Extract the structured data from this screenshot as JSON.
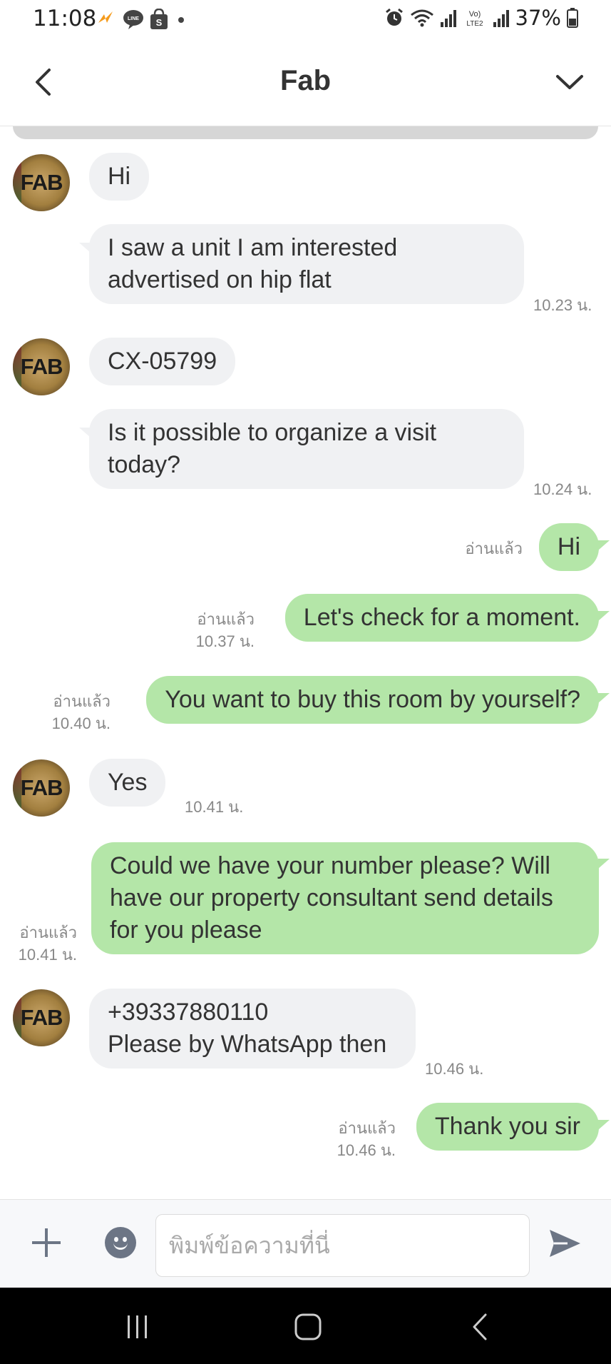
{
  "status_bar": {
    "time": "11:08",
    "battery": "37%",
    "left_icons": [
      "charging-app-icon",
      "line-icon",
      "shopee-icon",
      "dot-icon"
    ],
    "right_icons": [
      "alarm-icon",
      "wifi-icon",
      "signal-icon",
      "volte-icon",
      "signal-icon",
      "battery-icon"
    ]
  },
  "header": {
    "title": "Fab"
  },
  "avatar_text": "FAB",
  "messages": [
    {
      "side": "in",
      "text": "Hi"
    },
    {
      "side": "in",
      "text": "I saw a unit I am interested advertised on hip flat",
      "time": "10.23 น."
    },
    {
      "side": "in",
      "text": "CX-05799"
    },
    {
      "side": "in",
      "text": "Is it possible to organize a visit today?",
      "time": "10.24 น."
    },
    {
      "side": "out",
      "text": "Hi",
      "read": "อ่านแล้ว"
    },
    {
      "side": "out",
      "text": "Let's check for a moment.",
      "read": "อ่านแล้ว",
      "time": "10.37 น."
    },
    {
      "side": "out",
      "text": "You want to buy this room by yourself?",
      "read": "อ่านแล้ว",
      "time": "10.40 น."
    },
    {
      "side": "in",
      "text": "Yes",
      "time": "10.41 น."
    },
    {
      "side": "out",
      "text": "Could we have your number please? Will have our property consultant send details for you please",
      "read": "อ่านแล้ว",
      "time": "10.41 น."
    },
    {
      "side": "in",
      "text": "+39337880110\nPlease by WhatsApp then",
      "time": "10.46 น."
    },
    {
      "side": "out",
      "text": "Thank you sir",
      "read": "อ่านแล้ว",
      "time": "10.46 น."
    }
  ],
  "input": {
    "placeholder": "พิมพ์ข้อความที่นี่"
  },
  "colors": {
    "incoming_bubble": "#f0f1f3",
    "outgoing_bubble": "#b4e6a8",
    "meta_text": "#888888",
    "icon": "#6c7585"
  }
}
